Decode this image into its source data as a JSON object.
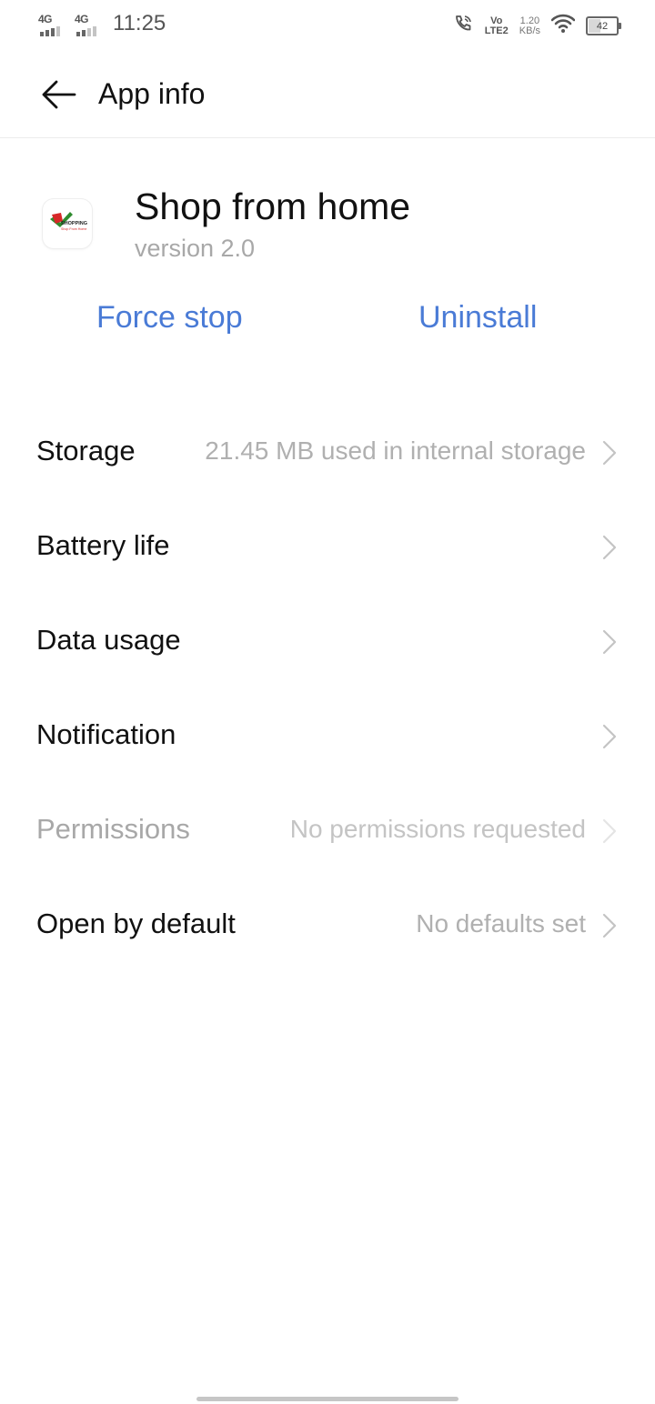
{
  "status_bar": {
    "sim1_network": "4G",
    "sim2_network": "4G",
    "time": "11:25",
    "volte_top": "Vo",
    "volte_bottom": "LTE2",
    "speed_value": "1.20",
    "speed_unit": "KB/s",
    "battery_level": "42",
    "icons": [
      "signal-icon",
      "signal-icon",
      "wifi-call-icon",
      "volte-icon",
      "wifi-icon",
      "battery-icon"
    ]
  },
  "header": {
    "title": "App info",
    "back_icon": "back-arrow-icon"
  },
  "app": {
    "name": "Shop from home",
    "version": "version 2.0",
    "icon_name": "shopping-app-icon",
    "icon_text": "SHOPPING",
    "icon_subtext": "Shop From Home"
  },
  "actions": {
    "force_stop": "Force stop",
    "uninstall": "Uninstall"
  },
  "settings": [
    {
      "label": "Storage",
      "value": "21.45 MB used in internal storage"
    },
    {
      "label": "Battery life",
      "value": ""
    },
    {
      "label": "Data usage",
      "value": ""
    },
    {
      "label": "Notification",
      "value": ""
    },
    {
      "label": "Permissions",
      "value": "No permissions requested"
    },
    {
      "label": "Open by default",
      "value": "No defaults set"
    }
  ],
  "colors": {
    "accent": "#4a7bd6",
    "text_primary": "#111111",
    "text_secondary": "#b0b0b0"
  }
}
